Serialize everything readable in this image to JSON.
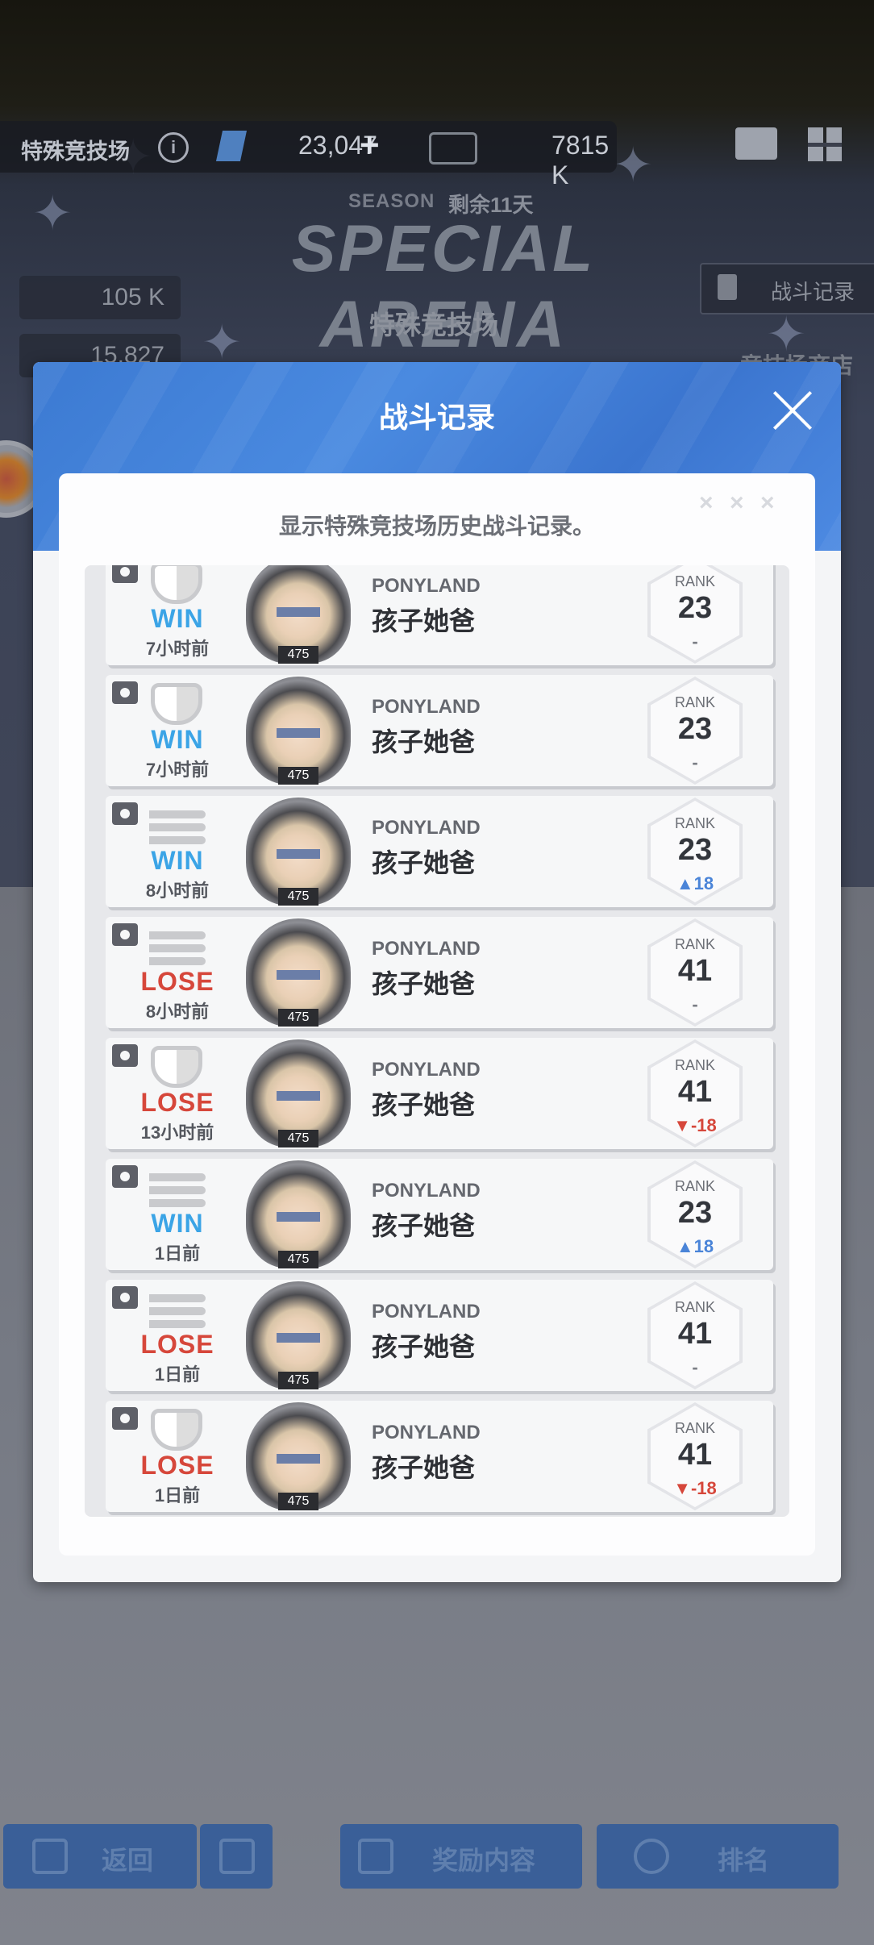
{
  "background": {
    "arena_name": "特殊竞技场",
    "gem_value": "23,047",
    "plus": "+",
    "ticket_value": "7815 K",
    "season_label": "SEASON",
    "season_remaining": "剩余11天",
    "title": "SPECIAL ARENA",
    "subtitle": "特殊竞技场",
    "resource1": "105 K",
    "resource2": "15,827",
    "battle_record_button": "战斗记录",
    "shop": "竞技场商店"
  },
  "bottom_nav": {
    "back": "返回",
    "rewards": "奖励内容",
    "ranking": "排名"
  },
  "modal": {
    "title": "战斗记录",
    "description": "显示特殊竞技场历史战斗记录。",
    "rank_label": "RANK",
    "records": [
      {
        "mode": "shield",
        "result": "WIN",
        "time": "7小时前",
        "level": "475",
        "guild": "PONYLAND",
        "name": "孩子她爸",
        "rank": "23",
        "change": "-"
      },
      {
        "mode": "shield",
        "result": "WIN",
        "time": "7小时前",
        "level": "475",
        "guild": "PONYLAND",
        "name": "孩子她爸",
        "rank": "23",
        "change": "-"
      },
      {
        "mode": "bullets",
        "result": "WIN",
        "time": "8小时前",
        "level": "475",
        "guild": "PONYLAND",
        "name": "孩子她爸",
        "rank": "23",
        "change": "▲18"
      },
      {
        "mode": "bullets",
        "result": "LOSE",
        "time": "8小时前",
        "level": "475",
        "guild": "PONYLAND",
        "name": "孩子她爸",
        "rank": "41",
        "change": "-"
      },
      {
        "mode": "shield",
        "result": "LOSE",
        "time": "13小时前",
        "level": "475",
        "guild": "PONYLAND",
        "name": "孩子她爸",
        "rank": "41",
        "change": "▼-18"
      },
      {
        "mode": "bullets",
        "result": "WIN",
        "time": "1日前",
        "level": "475",
        "guild": "PONYLAND",
        "name": "孩子她爸",
        "rank": "23",
        "change": "▲18"
      },
      {
        "mode": "bullets",
        "result": "LOSE",
        "time": "1日前",
        "level": "475",
        "guild": "PONYLAND",
        "name": "孩子她爸",
        "rank": "41",
        "change": "-"
      },
      {
        "mode": "shield",
        "result": "LOSE",
        "time": "1日前",
        "level": "475",
        "guild": "PONYLAND",
        "name": "孩子她爸",
        "rank": "41",
        "change": "▼-18"
      }
    ]
  },
  "colors": {
    "header_blue": "#3c7ad2",
    "win": "#3ba4e6",
    "lose": "#d6473b",
    "rank_up": "#4a84d8",
    "rank_down": "#d6473b"
  }
}
